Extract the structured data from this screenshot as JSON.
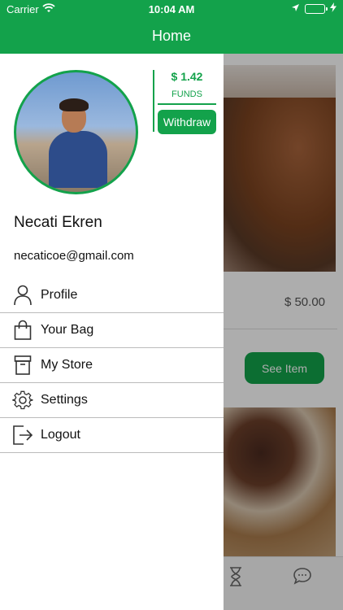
{
  "status_bar": {
    "carrier": "Carrier",
    "time": "10:04 AM"
  },
  "nav": {
    "title": "Home"
  },
  "drawer": {
    "user_name": "Necati Ekren",
    "email": "necaticoe@gmail.com",
    "funds": {
      "amount": "$ 1.42",
      "label": "FUNDS",
      "withdraw_label": "Withdraw"
    },
    "menu": [
      {
        "label": "Profile",
        "icon": "person-icon"
      },
      {
        "label": "Your Bag",
        "icon": "bag-icon"
      },
      {
        "label": "My Store",
        "icon": "store-icon"
      },
      {
        "label": "Settings",
        "icon": "gear-icon"
      },
      {
        "label": "Logout",
        "icon": "logout-icon"
      }
    ]
  },
  "background": {
    "price": "$ 50.00",
    "see_item_label": "See Item"
  },
  "colors": {
    "brand_green": "#13a24b"
  }
}
